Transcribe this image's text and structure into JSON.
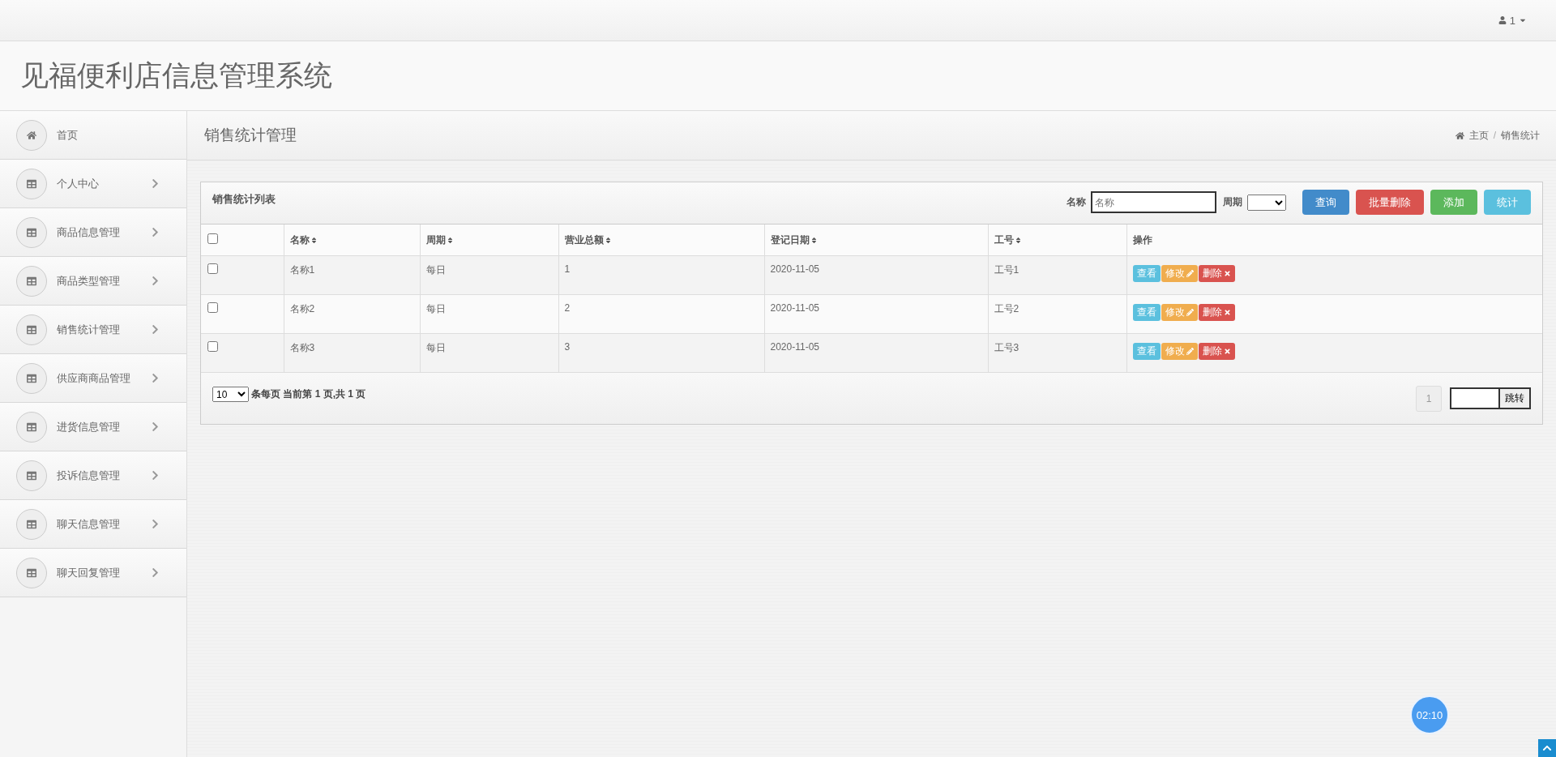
{
  "top_bar": {
    "user": "1"
  },
  "header": {
    "title": "见福便利店信息管理系统"
  },
  "sidebar": {
    "items": [
      {
        "label": "首页",
        "kind": "home"
      },
      {
        "label": "个人中心",
        "kind": "menu"
      },
      {
        "label": "商品信息管理",
        "kind": "menu"
      },
      {
        "label": "商品类型管理",
        "kind": "menu"
      },
      {
        "label": "销售统计管理",
        "kind": "menu"
      },
      {
        "label": "供应商商品管理",
        "kind": "menu"
      },
      {
        "label": "进货信息管理",
        "kind": "menu"
      },
      {
        "label": "投诉信息管理",
        "kind": "menu"
      },
      {
        "label": "聊天信息管理",
        "kind": "menu"
      },
      {
        "label": "聊天回复管理",
        "kind": "menu"
      }
    ]
  },
  "page_header": {
    "title": "销售统计管理",
    "breadcrumb": {
      "items": [
        "主页",
        "销售统计"
      ],
      "separator": "/"
    }
  },
  "panel": {
    "title": "销售统计列表",
    "filters": [
      {
        "label": "名称",
        "kind": "text",
        "placeholder": "名称"
      },
      {
        "label": "周期",
        "kind": "select"
      }
    ],
    "buttons": [
      {
        "label": "查询",
        "kind": "primary"
      },
      {
        "label": "批量删除",
        "kind": "danger"
      },
      {
        "label": "添加",
        "kind": "success"
      },
      {
        "label": "统计",
        "kind": "info"
      }
    ],
    "table": {
      "header_checked": false,
      "columns": [
        {
          "label": "名称",
          "sortable": true
        },
        {
          "label": "周期",
          "sortable": true
        },
        {
          "label": "营业总额",
          "sortable": true
        },
        {
          "label": "登记日期",
          "sortable": true
        },
        {
          "label": "工号",
          "sortable": true
        },
        {
          "label": "操作",
          "sortable": false
        }
      ],
      "rows": [
        {
          "checked": false,
          "cells": [
            "名称1",
            "每日",
            "1",
            "2020-11-05",
            "工号1"
          ],
          "actions": [
            {
              "label": "查看",
              "kind": "view"
            },
            {
              "label": "修改",
              "kind": "edit"
            },
            {
              "label": "删除",
              "kind": "delete"
            }
          ]
        },
        {
          "checked": false,
          "cells": [
            "名称2",
            "每日",
            "2",
            "2020-11-05",
            "工号2"
          ],
          "actions": [
            {
              "label": "查看",
              "kind": "view"
            },
            {
              "label": "修改",
              "kind": "edit"
            },
            {
              "label": "删除",
              "kind": "delete"
            }
          ]
        },
        {
          "checked": false,
          "cells": [
            "名称3",
            "每日",
            "3",
            "2020-11-05",
            "工号3"
          ],
          "actions": [
            {
              "label": "查看",
              "kind": "view"
            },
            {
              "label": "修改",
              "kind": "edit"
            },
            {
              "label": "删除",
              "kind": "delete"
            }
          ]
        }
      ]
    },
    "footer": {
      "page_size": "10",
      "summary": "条每页 当前第 1 页,共 1 页",
      "pages": [
        {
          "label": "1",
          "selected": true
        }
      ],
      "jump_button": "跳转"
    }
  },
  "timer": "02:10"
}
